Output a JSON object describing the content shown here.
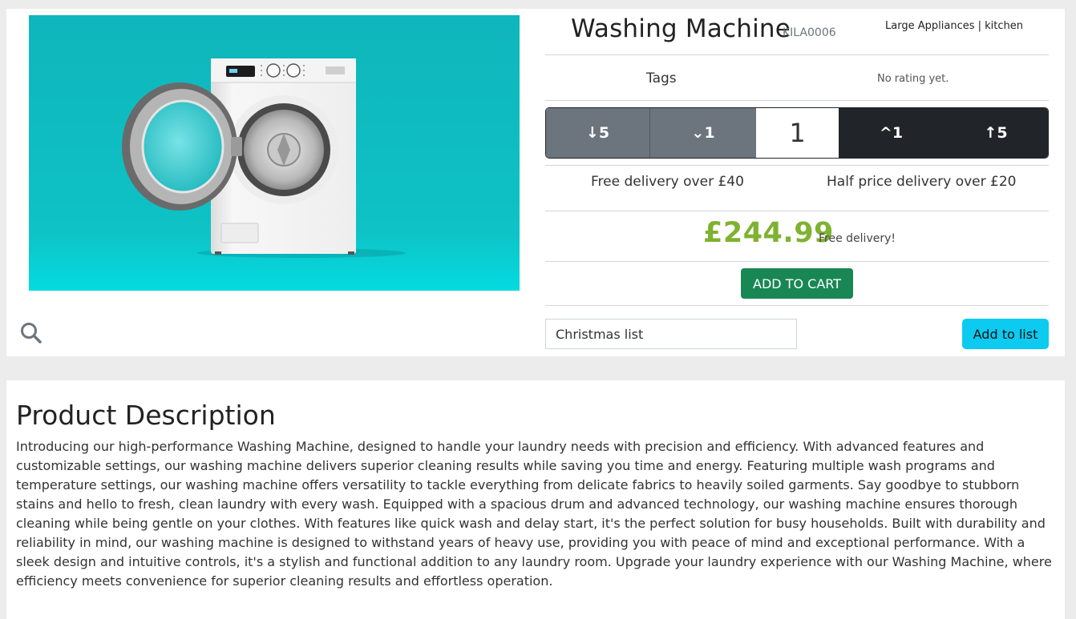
{
  "product": {
    "title": "Washing Machine",
    "sku": "KILA0006",
    "categories": "Large Appliances | kitchen",
    "tags_label": "Tags",
    "rating_text": "No rating yet.",
    "image_alt": "washing-machine-photo",
    "image_bg": "#13c3c7"
  },
  "quantity": {
    "down5": "↓5",
    "down1": "⌄1",
    "value": "1",
    "up1": "^1",
    "up5": "↑5"
  },
  "delivery": {
    "free": "Free delivery over £40",
    "half": "Half price delivery over £20"
  },
  "price": {
    "amount": "£244.99",
    "note": "Free delivery!",
    "color": "#7fb230"
  },
  "actions": {
    "add_to_cart": "ADD TO CART",
    "list_value": "Christmas list",
    "add_to_list": "Add to list"
  },
  "description": {
    "title": "Product Description",
    "text": "Introducing our high-performance Washing Machine, designed to handle your laundry needs with precision and efficiency. With advanced features and customizable settings, our washing machine delivers superior cleaning results while saving you time and energy. Featuring multiple wash programs and temperature settings, our washing machine offers versatility to tackle everything from delicate fabrics to heavily soiled garments. Say goodbye to stubborn stains and hello to fresh, clean laundry with every wash. Equipped with a spacious drum and advanced technology, our washing machine ensures thorough cleaning while being gentle on your clothes. With features like quick wash and delay start, it's the perfect solution for busy households. Built with durability and reliability in mind, our washing machine is designed to withstand years of heavy use, providing you with peace of mind and exceptional performance. With a sleek design and intuitive controls, it's a stylish and functional addition to any laundry room. Upgrade your laundry experience with our Washing Machine, where efficiency meets convenience for superior cleaning results and effortless operation."
  },
  "icons": {
    "zoom": "search-icon"
  }
}
